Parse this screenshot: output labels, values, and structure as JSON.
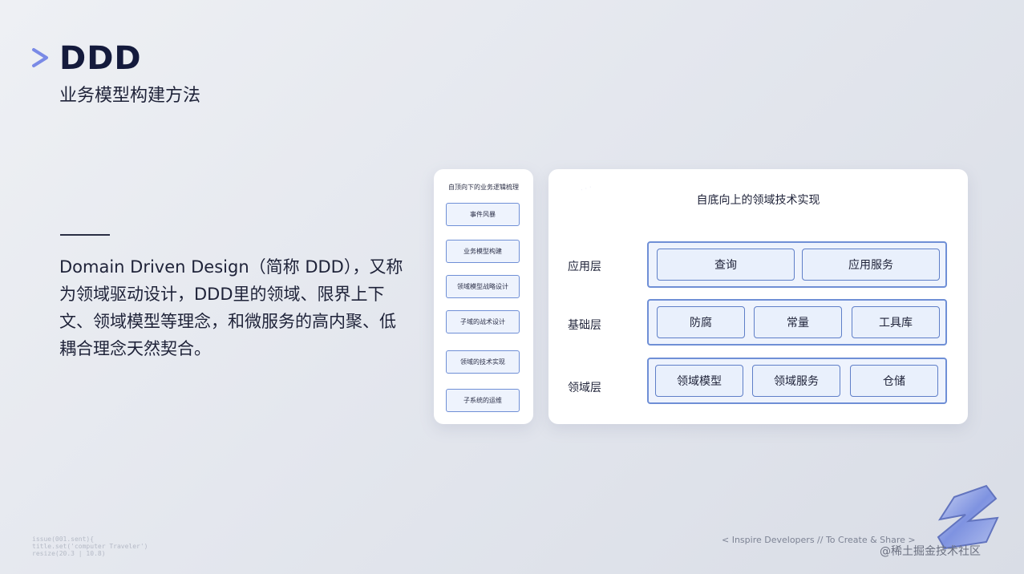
{
  "header": {
    "title": "DDD",
    "subtitle": "业务模型构建方法"
  },
  "description": "Domain Driven Design（简称 DDD），又称为领域驱动设计，DDD里的领域、限界上下文、领域模型等理念，和微服务的高内聚、低耦合理念天然契合。",
  "left_panel": {
    "title": "自顶向下的业务逻辑梳理",
    "steps": [
      "事件风暴",
      "业务模型构建",
      "领域模型战略设计",
      "子域的战术设计",
      "领域的技术实现",
      "子系统的运维"
    ]
  },
  "main_panel": {
    "title": "自底向上的领域技术实现",
    "layers": [
      {
        "label": "应用层",
        "items": [
          "查询",
          "应用服务"
        ]
      },
      {
        "label": "基础层",
        "items": [
          "防腐",
          "常量",
          "工具库"
        ]
      },
      {
        "label": "领域层",
        "items": [
          "领域模型",
          "领域服务",
          "仓储"
        ]
      }
    ]
  },
  "footer": {
    "code_lines": [
      "issue(001.sent){",
      "title.set('computer Traveler')",
      "resize(20.3 | 10.8)"
    ],
    "slogan": "< Inspire Developers  //  To Create & Share >",
    "credit": "@稀土掘金技术社区"
  },
  "colors": {
    "accent": "#6f8fd6",
    "box_fill": "#eef3fd",
    "title_text": "#141a3c"
  }
}
